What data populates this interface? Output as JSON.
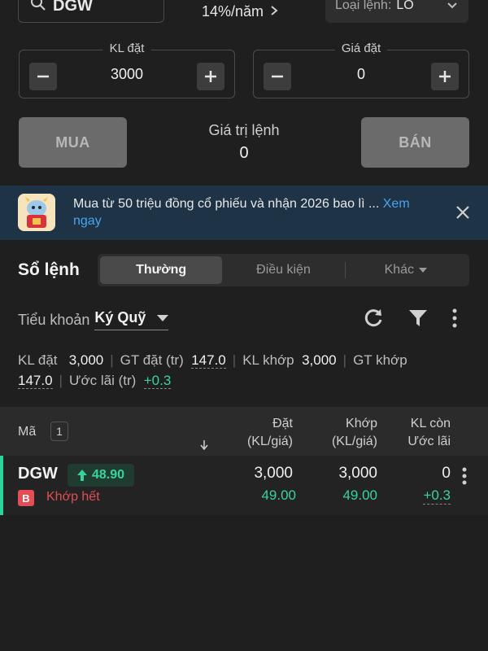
{
  "top": {
    "symbol": "DGW",
    "rate": "14%/năm",
    "order_type_label": "Loại lệnh:",
    "order_type_value": "LO"
  },
  "quantity": {
    "label": "KL đặt",
    "value": "3000"
  },
  "price": {
    "label": "Giá đặt",
    "value": "0"
  },
  "actions": {
    "buy": "MUA",
    "sell": "BÁN",
    "order_value_label": "Giá trị lệnh",
    "order_value": "0"
  },
  "banner": {
    "text": "Mua từ 50 triệu đồng cổ phiếu và nhận 2026 bao lì ... ",
    "link": "Xem ngay"
  },
  "orders": {
    "title": "Sổ lệnh",
    "tabs": [
      {
        "label": "Thường"
      },
      {
        "label": "Điều kiện"
      },
      {
        "label": "Khác"
      }
    ],
    "subaccount_label": "Tiểu khoản",
    "subaccount_value": "Ký Quỹ"
  },
  "summary": {
    "kl_dat_label": "KL đặt",
    "kl_dat": "3,000",
    "gt_dat_label": "GT đặt (tr)",
    "gt_dat": "147.0",
    "kl_khop_label": "KL khớp",
    "kl_khop": "3,000",
    "gt_khop_label": "GT khớp",
    "gt_khop": "147.0",
    "uoc_lai_label": "Ước lãi (tr)",
    "uoc_lai": "+0.3"
  },
  "table": {
    "col_symbol": "Mã",
    "count": "1",
    "col_dat": [
      "Đặt",
      "(KL/giá)"
    ],
    "col_khop": [
      "Khớp",
      "(KL/giá)"
    ],
    "col_klcon": [
      "KL còn",
      "Ước lãi"
    ],
    "rows": [
      {
        "symbol": "DGW",
        "change": "48.90",
        "side": "B",
        "status": "Khớp hết",
        "dat_kl": "3,000",
        "dat_gia": "49.00",
        "khop_kl": "3,000",
        "khop_gia": "49.00",
        "kl_con": "0",
        "uoc_lai": "+0.3"
      }
    ]
  },
  "colors": {
    "background": "#1f1f1f",
    "green": "#38d39f",
    "red": "#e34d55",
    "link": "#4aa3f0",
    "banner": "#1e3446"
  }
}
